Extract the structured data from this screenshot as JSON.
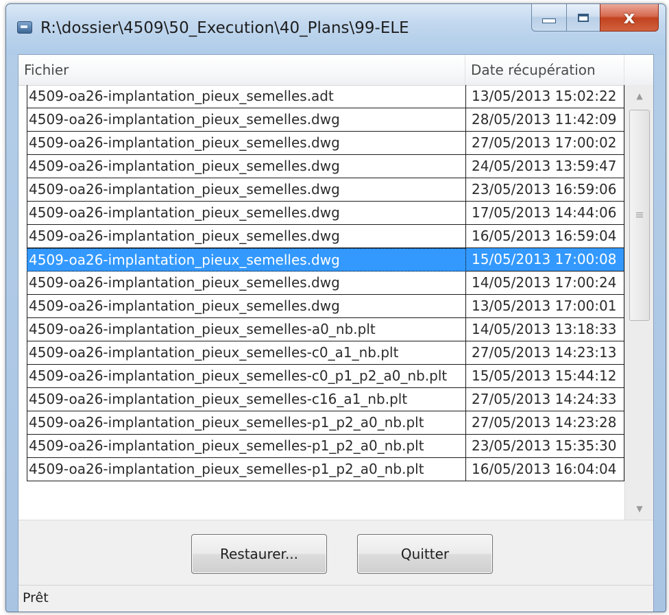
{
  "window": {
    "title": "R:\\dossier\\4509\\50_Execution\\40_Plans\\99-ELE",
    "close_glyph": "x"
  },
  "table": {
    "columns": [
      "Fichier",
      "Date récupération"
    ],
    "selected_index": 7,
    "rows": [
      {
        "file": "4509-oa26-implantation_pieux_semelles.adt",
        "date": "13/05/2013 15:02:22"
      },
      {
        "file": "4509-oa26-implantation_pieux_semelles.dwg",
        "date": "28/05/2013 11:42:09"
      },
      {
        "file": "4509-oa26-implantation_pieux_semelles.dwg",
        "date": "27/05/2013 17:00:02"
      },
      {
        "file": "4509-oa26-implantation_pieux_semelles.dwg",
        "date": "24/05/2013 13:59:47"
      },
      {
        "file": "4509-oa26-implantation_pieux_semelles.dwg",
        "date": "23/05/2013 16:59:06"
      },
      {
        "file": "4509-oa26-implantation_pieux_semelles.dwg",
        "date": "17/05/2013 14:44:06"
      },
      {
        "file": "4509-oa26-implantation_pieux_semelles.dwg",
        "date": "16/05/2013 16:59:04"
      },
      {
        "file": "4509-oa26-implantation_pieux_semelles.dwg",
        "date": "15/05/2013 17:00:08"
      },
      {
        "file": "4509-oa26-implantation_pieux_semelles.dwg",
        "date": "14/05/2013 17:00:24"
      },
      {
        "file": "4509-oa26-implantation_pieux_semelles.dwg",
        "date": "13/05/2013 17:00:01"
      },
      {
        "file": "4509-oa26-implantation_pieux_semelles-a0_nb.plt",
        "date": "14/05/2013 13:18:33"
      },
      {
        "file": "4509-oa26-implantation_pieux_semelles-c0_a1_nb.plt",
        "date": "27/05/2013 14:23:13"
      },
      {
        "file": "4509-oa26-implantation_pieux_semelles-c0_p1_p2_a0_nb.plt",
        "date": "15/05/2013 15:44:12"
      },
      {
        "file": "4509-oa26-implantation_pieux_semelles-c16_a1_nb.plt",
        "date": "27/05/2013 14:24:33"
      },
      {
        "file": "4509-oa26-implantation_pieux_semelles-p1_p2_a0_nb.plt",
        "date": "27/05/2013 14:23:28"
      },
      {
        "file": "4509-oa26-implantation_pieux_semelles-p1_p2_a0_nb.plt",
        "date": "23/05/2013 15:35:30"
      },
      {
        "file": "4509-oa26-implantation_pieux_semelles-p1_p2_a0_nb.plt",
        "date": "16/05/2013 16:04:04"
      }
    ]
  },
  "buttons": {
    "restore_label": "Restaurer...",
    "quit_label": "Quitter"
  },
  "status": {
    "text": "Prêt"
  },
  "icons": {
    "app": "app-window-icon",
    "minimize": "minimize-icon",
    "maximize": "maximize-icon",
    "close": "close-icon",
    "scroll_up": "scroll-up-arrow-icon",
    "scroll_down": "scroll-down-arrow-icon"
  },
  "colors": {
    "selection": "#3399ff",
    "close_button": "#c2421f"
  }
}
